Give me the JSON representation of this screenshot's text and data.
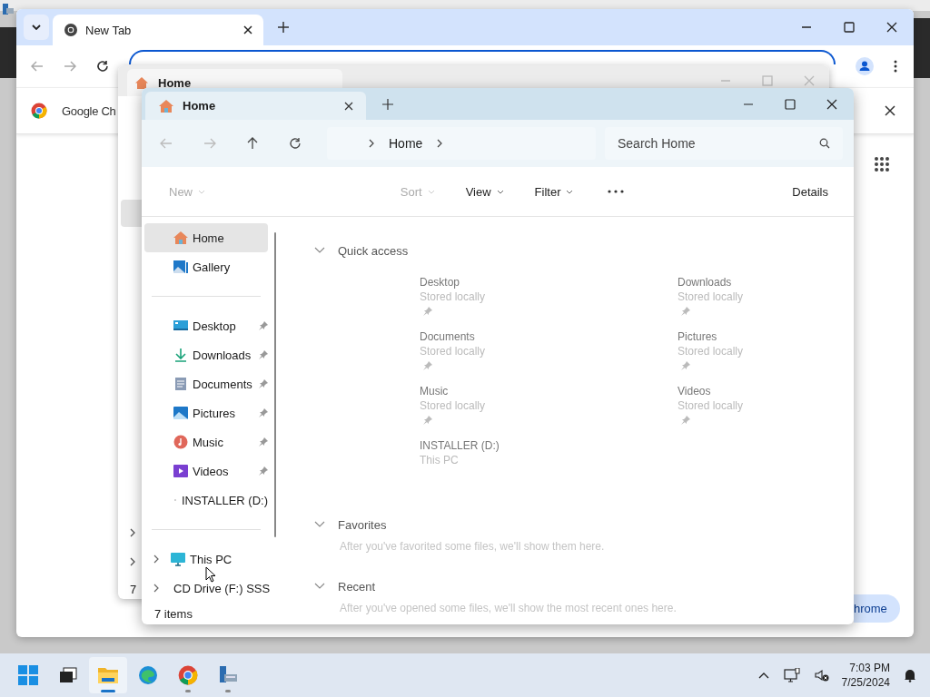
{
  "browser": {
    "tab": {
      "title": "New Tab",
      "selected": true
    },
    "banner": {
      "text": "Google Ch"
    },
    "button": {
      "text": "hrome"
    }
  },
  "back_explorer": {
    "tab": {
      "title": "Home"
    },
    "status": "7"
  },
  "explorer": {
    "tab": {
      "title": "Home"
    },
    "breadcrumb": [
      "Home"
    ],
    "search": {
      "placeholder": "Search Home"
    },
    "commands": [
      {
        "label": "New",
        "disabled": true
      },
      {
        "label": "Sort",
        "disabled": true
      },
      {
        "label": "View",
        "disabled": false
      },
      {
        "label": "Filter",
        "disabled": false
      }
    ],
    "details": "Details",
    "nav_top": [
      {
        "label": "Home",
        "kind": "home",
        "selected": true
      },
      {
        "label": "Gallery",
        "kind": "gallery",
        "selected": false
      }
    ],
    "nav_pinned": [
      {
        "label": "Desktop",
        "kind": "desktop",
        "pinned": true,
        "selected": false
      },
      {
        "label": "Downloads",
        "kind": "downloads",
        "pinned": true,
        "selected": false
      },
      {
        "label": "Documents",
        "kind": "documents",
        "pinned": true,
        "selected": false
      },
      {
        "label": "Pictures",
        "kind": "pictures",
        "pinned": true,
        "selected": false
      },
      {
        "label": "Music",
        "kind": "music",
        "pinned": true,
        "selected": false
      },
      {
        "label": "Videos",
        "kind": "videos",
        "pinned": true,
        "selected": false
      },
      {
        "label": "INSTALLER (D:)",
        "kind": "drive",
        "pinned": false,
        "selected": false
      }
    ],
    "nav_drives": [
      {
        "label": "This PC",
        "kind": "pc",
        "expanded": false,
        "selected": false
      },
      {
        "label": "CD Drive (F:) SSS",
        "kind": "cd",
        "expanded": false,
        "selected": false
      }
    ],
    "quick_access": {
      "title": "Quick access",
      "expanded": true,
      "items": [
        {
          "name": "Desktop",
          "detail": "Stored locally",
          "pinned": true
        },
        {
          "name": "Downloads",
          "detail": "Stored locally",
          "pinned": true
        },
        {
          "name": "Documents",
          "detail": "Stored locally",
          "pinned": true
        },
        {
          "name": "Pictures",
          "detail": "Stored locally",
          "pinned": true
        },
        {
          "name": "Music",
          "detail": "Stored locally",
          "pinned": true
        },
        {
          "name": "Videos",
          "detail": "Stored locally",
          "pinned": true
        },
        {
          "name": "INSTALLER (D:)",
          "detail": "This PC",
          "pinned": false
        }
      ]
    },
    "sections": [
      {
        "title": "Favorites",
        "expanded": true,
        "message": "After you've favorited some files, we'll show them here."
      },
      {
        "title": "Recent",
        "expanded": true,
        "message": "After you've opened some files, we'll show the most recent ones here."
      }
    ],
    "status": "7 items"
  },
  "taskbar": {
    "apps": [
      {
        "kind": "start",
        "active": false,
        "running": false
      },
      {
        "kind": "taskview",
        "active": false,
        "running": false
      },
      {
        "kind": "explorer",
        "active": true,
        "running": true
      },
      {
        "kind": "edge",
        "active": false,
        "running": false
      },
      {
        "kind": "chrome",
        "active": false,
        "running": true
      },
      {
        "kind": "servermanager",
        "active": false,
        "running": true
      }
    ],
    "time": "7:03 PM",
    "date": "7/25/2024"
  }
}
